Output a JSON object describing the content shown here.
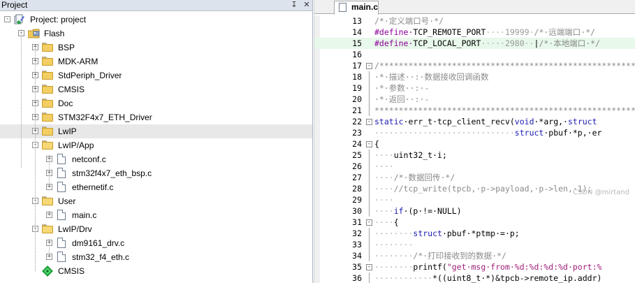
{
  "project_panel": {
    "title": "Project",
    "pin_icon": "pin-icon",
    "close_icon": "close-icon",
    "tree": [
      {
        "label": "Project: project",
        "type": "project",
        "level": 0,
        "expand": "-"
      },
      {
        "label": "Flash",
        "type": "target",
        "level": 1,
        "expand": "-"
      },
      {
        "label": "BSP",
        "type": "folder",
        "level": 2,
        "expand": "+"
      },
      {
        "label": "MDK-ARM",
        "type": "folder",
        "level": 2,
        "expand": "+"
      },
      {
        "label": "StdPeriph_Driver",
        "type": "folder",
        "level": 2,
        "expand": "+"
      },
      {
        "label": "CMSIS",
        "type": "folder",
        "level": 2,
        "expand": "+"
      },
      {
        "label": "Doc",
        "type": "folder",
        "level": 2,
        "expand": "+"
      },
      {
        "label": "STM32F4x7_ETH_Driver",
        "type": "folder",
        "level": 2,
        "expand": "+"
      },
      {
        "label": "LwIP",
        "type": "folder",
        "level": 2,
        "expand": "+",
        "selected": true
      },
      {
        "label": "LwIP/App",
        "type": "folder-open",
        "level": 2,
        "expand": "-"
      },
      {
        "label": "netconf.c",
        "type": "file",
        "level": 3,
        "expand": "+"
      },
      {
        "label": "stm32f4x7_eth_bsp.c",
        "type": "file",
        "level": 3,
        "expand": "+"
      },
      {
        "label": "ethernetif.c",
        "type": "file",
        "level": 3,
        "expand": "+"
      },
      {
        "label": "User",
        "type": "folder-open",
        "level": 2,
        "expand": "-"
      },
      {
        "label": "main.c",
        "type": "file",
        "level": 3,
        "expand": "+"
      },
      {
        "label": "LwIP/Drv",
        "type": "folder-open",
        "level": 2,
        "expand": "-"
      },
      {
        "label": "dm9161_drv.c",
        "type": "file",
        "level": 3,
        "expand": "+"
      },
      {
        "label": "stm32_f4_eth.c",
        "type": "file",
        "level": 3,
        "expand": "+"
      },
      {
        "label": "CMSIS",
        "type": "cmsis",
        "level": 2,
        "expand": ""
      }
    ]
  },
  "editor": {
    "tab_label": "main.c",
    "watermark": "CSDN @mirtand",
    "lines": [
      {
        "n": "13",
        "fold": "",
        "hl": false,
        "tokens": [
          [
            "c-cm",
            "/*·定义端口号·*/"
          ]
        ]
      },
      {
        "n": "14",
        "fold": "",
        "hl": false,
        "tokens": [
          [
            "c-pp",
            "#define·"
          ],
          [
            "c-id",
            "TCP_REMOTE_PORT"
          ],
          [
            "c-dot",
            "····"
          ],
          [
            "c-cn",
            "19999"
          ],
          [
            "c-dot",
            "·"
          ],
          [
            "c-cm",
            "/*·远端端口·*/"
          ]
        ]
      },
      {
        "n": "15",
        "fold": "",
        "hl": true,
        "tokens": [
          [
            "c-pp",
            "#define·"
          ],
          [
            "c-id",
            "TCP_LOCAL_PORT"
          ],
          [
            "c-dot",
            "·····"
          ],
          [
            "c-cn",
            "2980"
          ],
          [
            "c-dot",
            "··"
          ],
          [
            "c-id",
            "|"
          ],
          [
            "c-cm",
            "/*·本地端口·*/"
          ]
        ]
      },
      {
        "n": "16",
        "fold": "",
        "hl": false,
        "tokens": []
      },
      {
        "n": "17",
        "fold": "-",
        "hl": false,
        "tokens": [
          [
            "c-cm",
            "/*******************************************************"
          ]
        ]
      },
      {
        "n": "18",
        "fold": "|",
        "hl": false,
        "tokens": [
          [
            "c-cm",
            "·*·描述··:·数据接收回调函数"
          ]
        ]
      },
      {
        "n": "19",
        "fold": "|",
        "hl": false,
        "tokens": [
          [
            "c-cm",
            "·*·参数··:·-"
          ]
        ]
      },
      {
        "n": "20",
        "fold": "|",
        "hl": false,
        "tokens": [
          [
            "c-cm",
            "·*·返回··:·-"
          ]
        ]
      },
      {
        "n": "21",
        "fold": "|",
        "hl": false,
        "tokens": [
          [
            "c-cm",
            "*******************************************************"
          ]
        ]
      },
      {
        "n": "22",
        "fold": "-",
        "hl": false,
        "tokens": [
          [
            "c-kw",
            "static"
          ],
          [
            "c-id",
            "·err_t·tcp_client_recv("
          ],
          [
            "c-kw",
            "void"
          ],
          [
            "c-id",
            "·*arg,·"
          ],
          [
            "c-kw",
            "struct"
          ]
        ]
      },
      {
        "n": "23",
        "fold": "",
        "hl": false,
        "tokens": [
          [
            "c-dot",
            "·····························"
          ],
          [
            "c-kw",
            "struct"
          ],
          [
            "c-id",
            "·pbuf·*p,·er"
          ]
        ]
      },
      {
        "n": "24",
        "fold": "-",
        "hl": false,
        "tokens": [
          [
            "c-id",
            "{"
          ]
        ]
      },
      {
        "n": "25",
        "fold": "|",
        "hl": false,
        "tokens": [
          [
            "c-dot",
            "····"
          ],
          [
            "c-id",
            "uint32_t·i;"
          ]
        ]
      },
      {
        "n": "26",
        "fold": "|",
        "hl": false,
        "tokens": [
          [
            "c-dot",
            "····"
          ]
        ]
      },
      {
        "n": "27",
        "fold": "|",
        "hl": false,
        "tokens": [
          [
            "c-dot",
            "····"
          ],
          [
            "c-cm",
            "/*·数据回传·*/"
          ]
        ]
      },
      {
        "n": "28",
        "fold": "|",
        "hl": false,
        "tokens": [
          [
            "c-dot",
            "····"
          ],
          [
            "c-cm",
            "//tcp_write(tpcb,·p->payload,·p->len,·1);"
          ]
        ]
      },
      {
        "n": "29",
        "fold": "|",
        "hl": false,
        "tokens": [
          [
            "c-dot",
            "····"
          ]
        ]
      },
      {
        "n": "30",
        "fold": "|",
        "hl": false,
        "tokens": [
          [
            "c-dot",
            "····"
          ],
          [
            "c-kw",
            "if"
          ],
          [
            "c-id",
            "·(p·!=·NULL)"
          ]
        ]
      },
      {
        "n": "31",
        "fold": "-",
        "hl": false,
        "tokens": [
          [
            "c-dot",
            "····"
          ],
          [
            "c-id",
            "{"
          ]
        ]
      },
      {
        "n": "32",
        "fold": "|",
        "hl": false,
        "tokens": [
          [
            "c-dot",
            "········"
          ],
          [
            "c-kw",
            "struct"
          ],
          [
            "c-id",
            "·pbuf·*ptmp·=·p;"
          ]
        ]
      },
      {
        "n": "33",
        "fold": "|",
        "hl": false,
        "tokens": [
          [
            "c-dot",
            "········"
          ]
        ]
      },
      {
        "n": "34",
        "fold": "|",
        "hl": false,
        "tokens": [
          [
            "c-dot",
            "········"
          ],
          [
            "c-cm",
            "/*·打印接收到的数据·*/"
          ]
        ]
      },
      {
        "n": "35",
        "fold": "-",
        "hl": false,
        "tokens": [
          [
            "c-dot",
            "········"
          ],
          [
            "c-id",
            "printf("
          ],
          [
            "c-str",
            "\"get·msg·from·%d:%d:%d:%d·port:%"
          ]
        ]
      },
      {
        "n": "36",
        "fold": "|",
        "hl": false,
        "tokens": [
          [
            "c-dot",
            "············"
          ],
          [
            "c-id",
            "*((uint8_t·*)&tpcb->remote_ip.addr)"
          ]
        ]
      }
    ]
  }
}
